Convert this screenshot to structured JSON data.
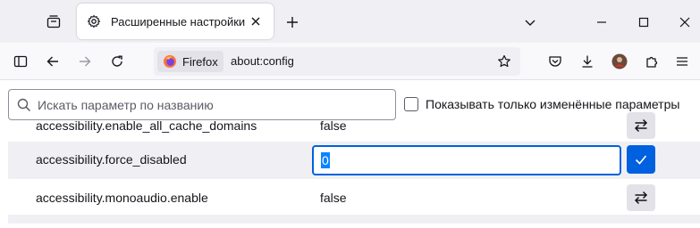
{
  "tab": {
    "title": "Расширенные настройки"
  },
  "urlbar": {
    "identity_label": "Firefox",
    "url": "about:config"
  },
  "config": {
    "search_placeholder": "Искать параметр по названию",
    "modified_only_label": "Показывать только изменённые параметры",
    "modified_only_checked": false,
    "prefs": [
      {
        "name": "accessibility.enable_all_cache_domains",
        "value": "false",
        "action": "toggle"
      },
      {
        "name": "accessibility.force_disabled",
        "value": "0",
        "action": "save",
        "editing": true
      },
      {
        "name": "accessibility.monoaudio.enable",
        "value": "false",
        "action": "toggle"
      }
    ]
  },
  "colors": {
    "accent": "#0061e0",
    "selection": "#0a84ff",
    "toolbar": "#f9f9fb",
    "tabstrip": "#f0f0f4"
  },
  "icons": {
    "tab_list": "tab-list-icon",
    "tab_favicon": "gear-icon",
    "close": "close-icon",
    "new_tab": "plus-icon",
    "overflow": "chevron-down-icon",
    "minimize": "minimize-icon",
    "maximize": "maximize-icon",
    "window_close": "close-icon",
    "sidebar": "sidebar-icon",
    "back": "back-arrow-icon",
    "forward": "forward-arrow-icon",
    "reload": "reload-icon",
    "firefox": "firefox-logo-icon",
    "bookmark": "star-icon",
    "pocket": "pocket-icon",
    "downloads": "download-icon",
    "account": "avatar",
    "extensions": "puzzle-icon",
    "menu": "hamburger-menu-icon",
    "search": "search-icon",
    "toggle": "swap-arrows-icon",
    "save": "checkmark-icon"
  }
}
